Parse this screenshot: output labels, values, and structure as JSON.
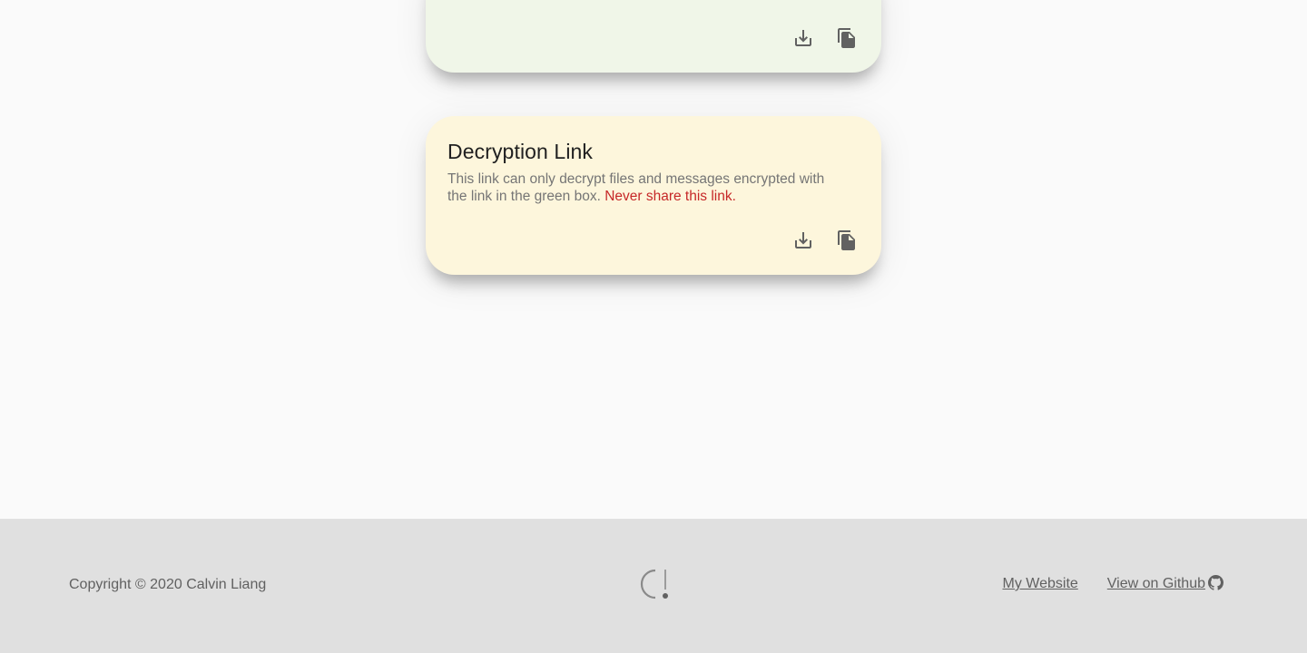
{
  "encryption_card": {
    "background": "#f0f6e8",
    "actions": [
      {
        "icon": "download-icon"
      },
      {
        "icon": "copy-icon"
      }
    ]
  },
  "decryption_card": {
    "background": "#fdf6dc",
    "title": "Decryption Link",
    "description": "This link can only decrypt files and messages encrypted with the link in the green box.",
    "warning": "Never share this link.",
    "warning_color": "#c62828",
    "actions": [
      {
        "icon": "download-icon"
      },
      {
        "icon": "copy-icon"
      }
    ]
  },
  "footer": {
    "copyright": "Copyright © 2020 Calvin Liang",
    "logo_icon": "app-logo-icon",
    "links": {
      "website": "My Website",
      "github": "View on Github",
      "github_icon": "github-icon"
    }
  }
}
